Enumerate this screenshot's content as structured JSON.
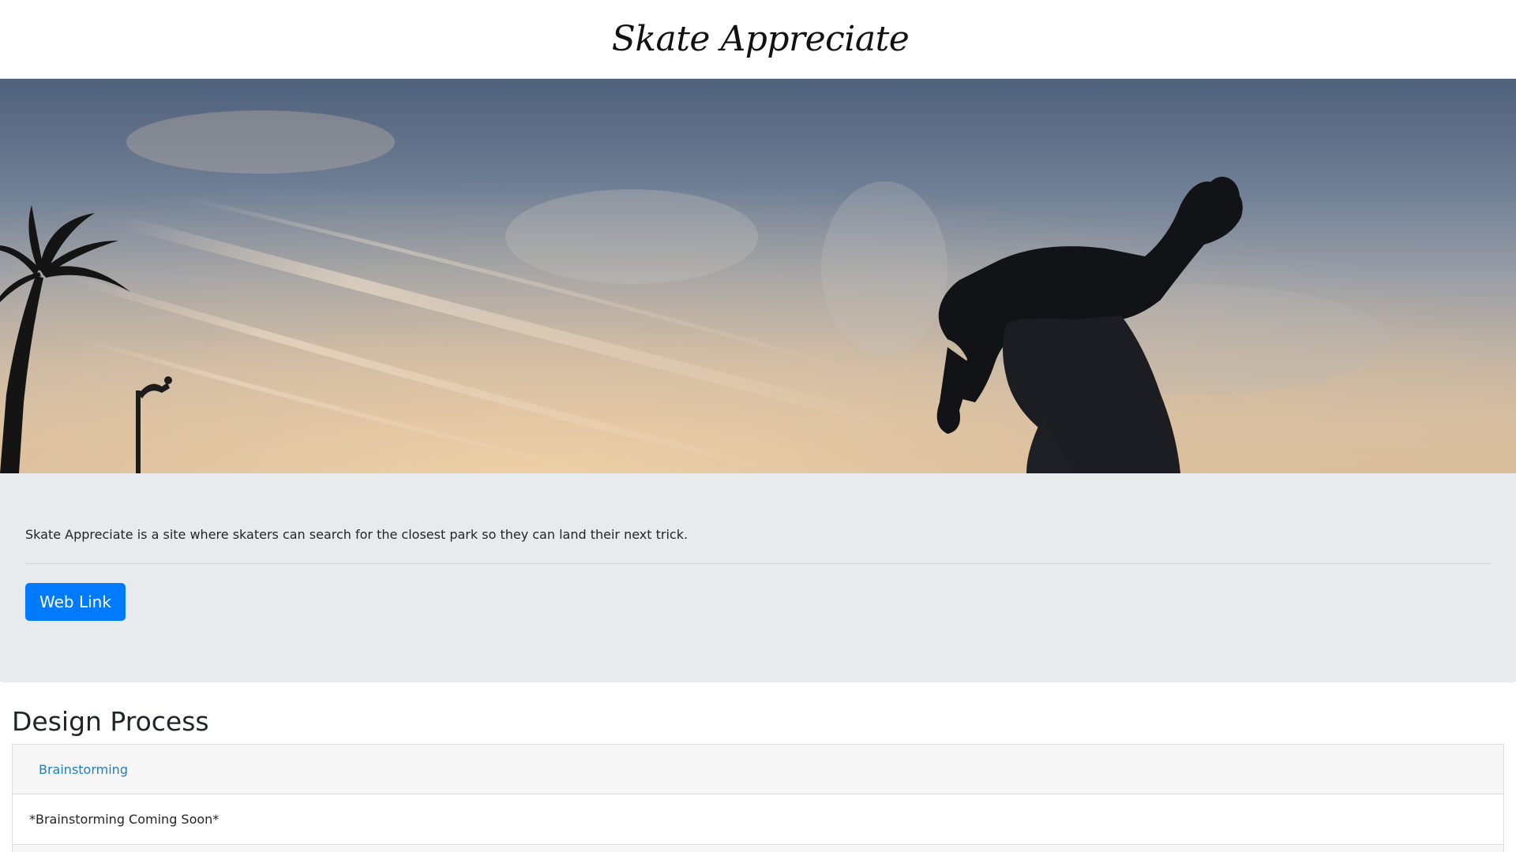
{
  "header": {
    "site_title": "Skate Appreciate"
  },
  "hero": {
    "image_description_icon": "skater-silhouette-sunset-image"
  },
  "jumbotron": {
    "lead_text": "Skate Appreciate is a site where skaters can search for the closest park so they can land their next trick.",
    "button_label": "Web Link",
    "button_color": "#007bff",
    "background_color": "#e8ebee"
  },
  "design_process": {
    "heading": "Design Process",
    "sections": [
      {
        "title": "Brainstorming",
        "content": "*Brainstorming Coming Soon*"
      }
    ]
  },
  "colors": {
    "link": "#1b7ec9",
    "text": "#212529"
  }
}
